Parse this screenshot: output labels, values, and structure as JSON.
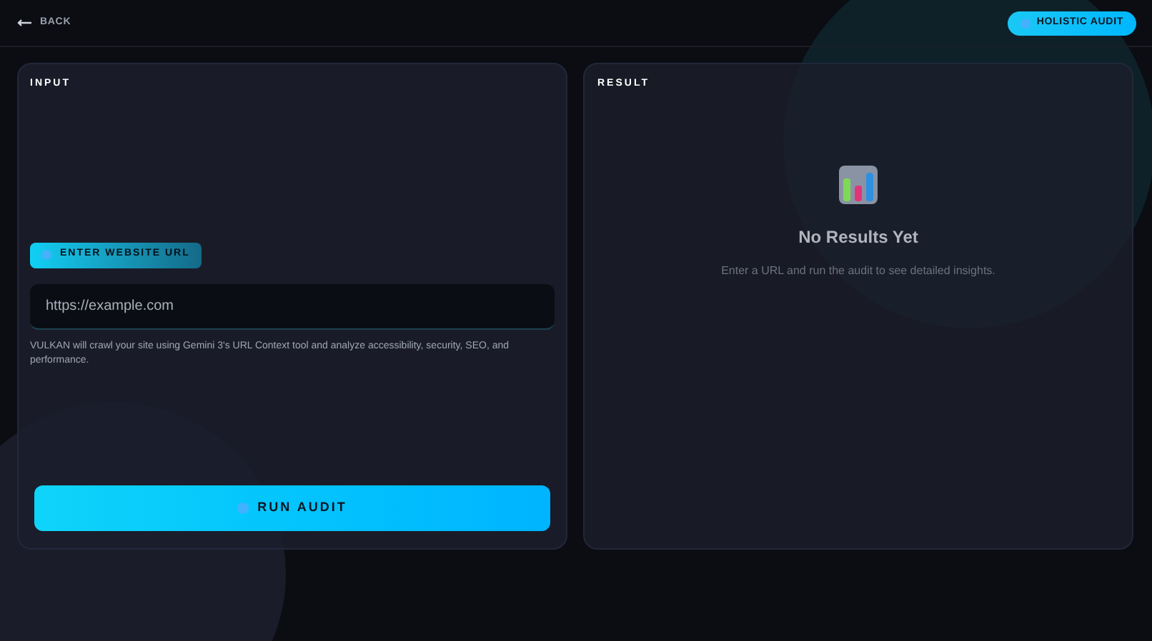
{
  "header": {
    "back_label": "BACK",
    "badge": "HOLISTIC AUDIT"
  },
  "input_panel": {
    "title": "INPUT",
    "step_label": "ENTER WEBSITE URL",
    "url_field": {
      "placeholder": "https://example.com"
    },
    "hint": "VULKAN will crawl your site using Gemini 3's URL Context tool and analyze accessibility, security, SEO, and performance.",
    "run_button": "RUN AUDIT"
  },
  "result_panel": {
    "title": "RESULT",
    "empty_title": "No Results Yet",
    "empty_text": "Enter a URL and run the audit to see detailed insights."
  }
}
